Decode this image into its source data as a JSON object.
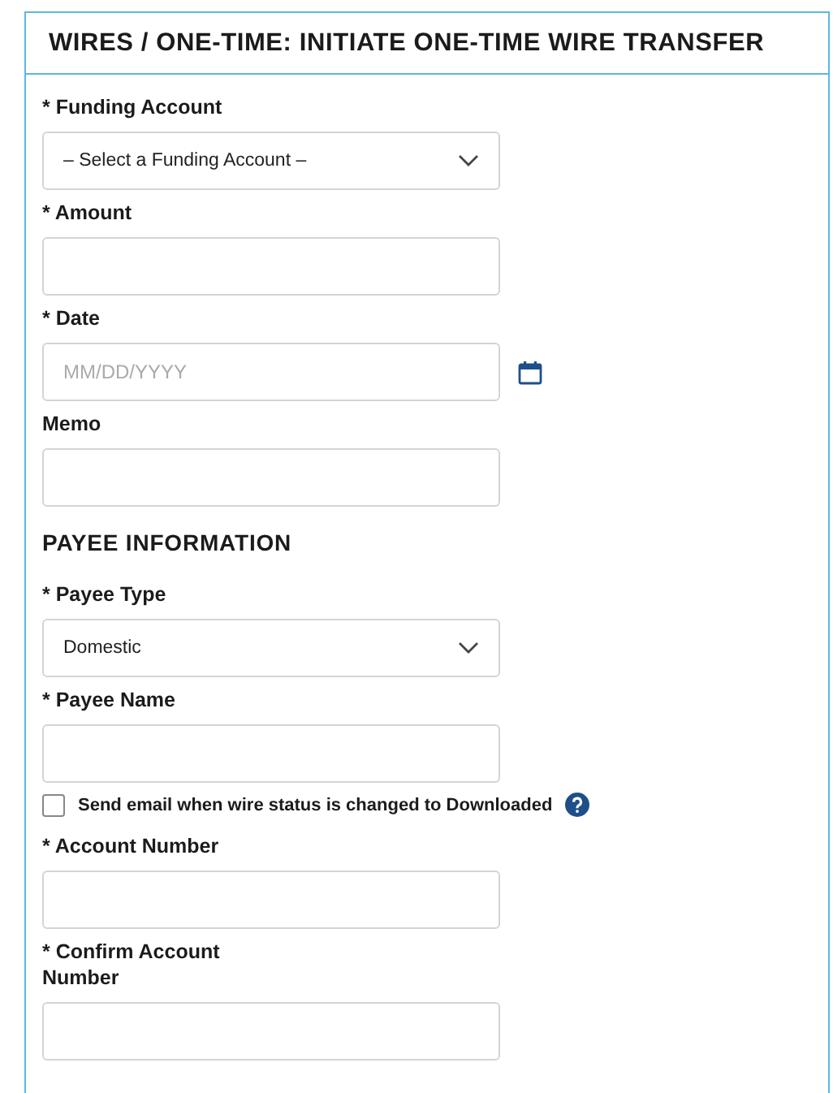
{
  "title": "WIRES / ONE-TIME: INITIATE ONE-TIME WIRE TRANSFER",
  "fields": [
    {
      "kind": "select",
      "label": "* Funding Account",
      "value": "– Select a Funding Account –"
    },
    {
      "kind": "text",
      "label": "* Amount"
    },
    {
      "kind": "date",
      "label": "* Date",
      "placeholder": "MM/DD/YYYY"
    },
    {
      "kind": "text",
      "label": "Memo"
    },
    {
      "kind": "heading",
      "label": "PAYEE INFORMATION"
    },
    {
      "kind": "select",
      "label": "* Payee Type",
      "value": "Domestic"
    },
    {
      "kind": "text",
      "label": "* Payee Name"
    },
    {
      "kind": "checkbox",
      "label": "Send email when wire status is changed to Downloaded",
      "checked": false
    },
    {
      "kind": "text",
      "label": "* Account Number"
    },
    {
      "kind": "text",
      "label": "* Confirm Account Number"
    }
  ]
}
